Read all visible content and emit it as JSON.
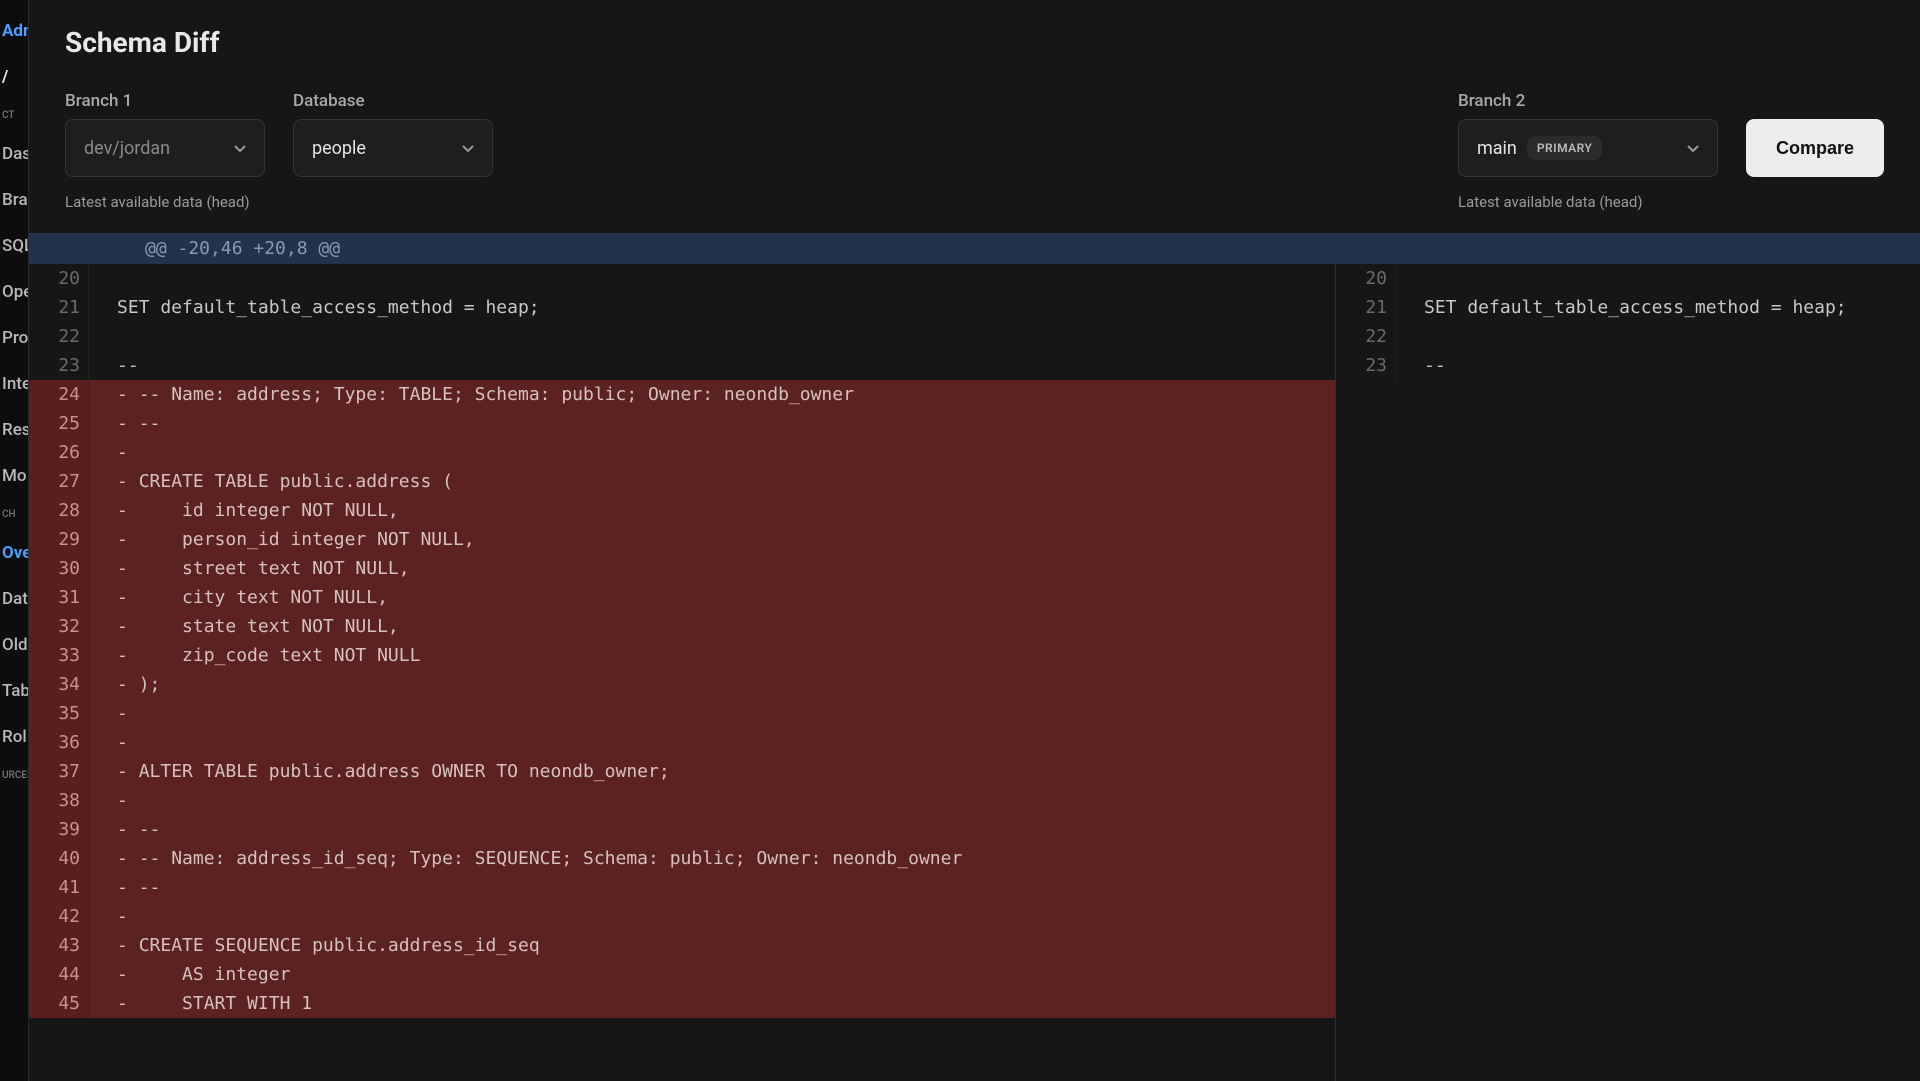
{
  "sidebar": {
    "items": [
      {
        "label": "Admi",
        "type": "blue"
      },
      {
        "label": "/",
        "type": "white-bold"
      },
      {
        "label": "CT",
        "type": "small"
      },
      {
        "label": "Das"
      },
      {
        "label": "Bra"
      },
      {
        "label": "SQL"
      },
      {
        "label": "Ope"
      },
      {
        "label": "Pro"
      },
      {
        "label": "Inte"
      },
      {
        "label": "Res"
      },
      {
        "label": "Mo"
      },
      {
        "label": "CH",
        "type": "small"
      },
      {
        "label": "Ove",
        "type": "blue"
      },
      {
        "label": "Dat"
      },
      {
        "label": "Old"
      },
      {
        "label": "Tab"
      },
      {
        "label": "Rol"
      },
      {
        "label": "URCES",
        "type": "small"
      }
    ]
  },
  "page": {
    "title": "Schema Diff"
  },
  "controls": {
    "branch1": {
      "label": "Branch 1",
      "value": "dev/jordan",
      "hint": "Latest available data (head)"
    },
    "database": {
      "label": "Database",
      "value": "people"
    },
    "branch2": {
      "label": "Branch 2",
      "value": "main",
      "badge": "PRIMARY",
      "hint": "Latest available data (head)"
    },
    "compare_label": "Compare"
  },
  "diff": {
    "hunk": "@@ -20,46 +20,8 @@",
    "left": [
      {
        "n": 20,
        "t": ""
      },
      {
        "n": 21,
        "t": "SET default_table_access_method = heap;"
      },
      {
        "n": 22,
        "t": ""
      },
      {
        "n": 23,
        "t": "--"
      },
      {
        "n": 24,
        "del": true,
        "t": "-- Name: address; Type: TABLE; Schema: public; Owner: neondb_owner"
      },
      {
        "n": 25,
        "del": true,
        "t": "--"
      },
      {
        "n": 26,
        "del": true,
        "t": ""
      },
      {
        "n": 27,
        "del": true,
        "t": "CREATE TABLE public.address ("
      },
      {
        "n": 28,
        "del": true,
        "t": "    id integer NOT NULL,"
      },
      {
        "n": 29,
        "del": true,
        "t": "    person_id integer NOT NULL,"
      },
      {
        "n": 30,
        "del": true,
        "t": "    street text NOT NULL,"
      },
      {
        "n": 31,
        "del": true,
        "t": "    city text NOT NULL,"
      },
      {
        "n": 32,
        "del": true,
        "t": "    state text NOT NULL,"
      },
      {
        "n": 33,
        "del": true,
        "t": "    zip_code text NOT NULL"
      },
      {
        "n": 34,
        "del": true,
        "t": ");"
      },
      {
        "n": 35,
        "del": true,
        "t": ""
      },
      {
        "n": 36,
        "del": true,
        "t": ""
      },
      {
        "n": 37,
        "del": true,
        "t": "ALTER TABLE public.address OWNER TO neondb_owner;"
      },
      {
        "n": 38,
        "del": true,
        "t": ""
      },
      {
        "n": 39,
        "del": true,
        "t": "--"
      },
      {
        "n": 40,
        "del": true,
        "t": "-- Name: address_id_seq; Type: SEQUENCE; Schema: public; Owner: neondb_owner"
      },
      {
        "n": 41,
        "del": true,
        "t": "--"
      },
      {
        "n": 42,
        "del": true,
        "t": ""
      },
      {
        "n": 43,
        "del": true,
        "t": "CREATE SEQUENCE public.address_id_seq"
      },
      {
        "n": 44,
        "del": true,
        "t": "    AS integer"
      },
      {
        "n": 45,
        "del": true,
        "t": "    START WITH 1"
      }
    ],
    "right": [
      {
        "n": 20,
        "t": ""
      },
      {
        "n": 21,
        "t": "SET default_table_access_method = heap;"
      },
      {
        "n": 22,
        "t": ""
      },
      {
        "n": 23,
        "t": "--"
      }
    ]
  }
}
